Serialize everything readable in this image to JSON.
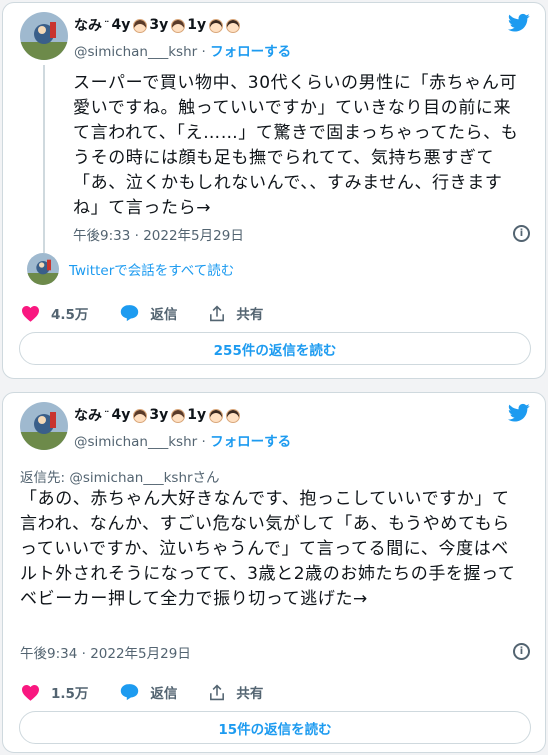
{
  "tweets": [
    {
      "author_name": "なみ",
      "name_suffix": "4y",
      "kid2": "3y",
      "kid3": "1y",
      "handle": "@simichan___kshr",
      "follow_label": "フォローする",
      "reply_to_label": "",
      "reply_to_handle": "",
      "reply_to_suffix": "",
      "text": "スーパーで買い物中、30代くらいの男性に「赤ちゃん可愛いですね。触っていいですか」ていきなり目の前に来て言われて、「え……」て驚きで固まっちゃってたら、もうその時には顔も足も撫でられてて、気持ち悪すぎて「あ、泣くかもしれないんで、、すみません、行きますね」て言ったら→",
      "timestamp": "午後9:33 · 2022年5月29日",
      "conversation_link": "Twitterで会話をすべて読む",
      "like_count": "4.5万",
      "reply_label": "返信",
      "share_label": "共有",
      "read_replies": "255件の返信を読む"
    },
    {
      "author_name": "なみ",
      "name_suffix": "4y",
      "kid2": "3y",
      "kid3": "1y",
      "handle": "@simichan___kshr",
      "follow_label": "フォローする",
      "reply_to_label": "返信先: ",
      "reply_to_handle": "@simichan___kshr",
      "reply_to_suffix": "さん",
      "text": "「あの、赤ちゃん大好きなんです、抱っこしていいですか」て言われ、なんか、すごい危ない気がして「あ、もうやめてもらっていいですか、泣いちゃうんで」て言ってる間に、今度はベルト外されそうになってて、3歳と2歳のお姉たちの手を握ってベビーカー押して全力で振り切って逃げた→",
      "timestamp": "午後9:34 · 2022年5月29日",
      "conversation_link": "",
      "like_count": "1.5万",
      "reply_label": "返信",
      "share_label": "共有",
      "read_replies": "15件の返信を読む"
    }
  ],
  "icons": {
    "brand": "twitter-bird-icon",
    "like": "heart-icon",
    "reply": "speech-bubble-icon",
    "share": "share-arrow-icon",
    "info": "info-icon"
  },
  "colors": {
    "accent": "#1d9bf0",
    "like": "#f91880",
    "muted": "#536471",
    "border": "#cfd9de"
  }
}
